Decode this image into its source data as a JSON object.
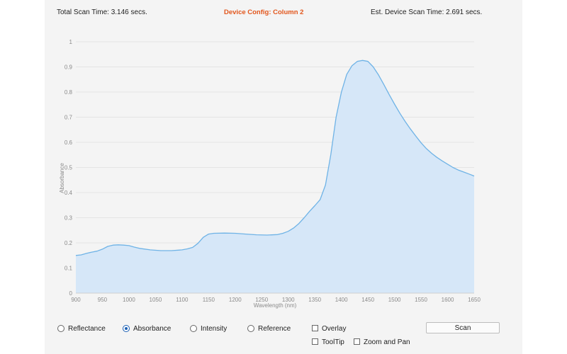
{
  "header": {
    "total_scan_time": "Total Scan Time: 3.146 secs.",
    "device_config": "Device Config: Column 2",
    "est_device_scan_time": "Est. Device Scan Time: 2.691 secs."
  },
  "colors": {
    "accent": "#e2561c",
    "fill": "#d6e7f8",
    "line": "#6fb3e6",
    "radio_selected": "#1a5fb4"
  },
  "chart_data": {
    "type": "area",
    "xlabel": "Wavelength (nm)",
    "ylabel": "Absorbance",
    "xlim": [
      900,
      1650
    ],
    "ylim": [
      0,
      1
    ],
    "x_ticks": [
      900,
      950,
      1000,
      1050,
      1100,
      1150,
      1200,
      1250,
      1300,
      1350,
      1400,
      1450,
      1500,
      1550,
      1600,
      1650
    ],
    "y_ticks": [
      0,
      0.1,
      0.2,
      0.3,
      0.4,
      0.5,
      0.6,
      0.7,
      0.8,
      0.9,
      1
    ],
    "y_tick_labels": [
      "0",
      "0.1",
      "0.2",
      "0.3",
      "0.4",
      "0.5",
      "0.6",
      "0.7",
      "0.8",
      "0.9",
      "1"
    ],
    "grid": "horizontal",
    "x": [
      900,
      910,
      920,
      930,
      940,
      950,
      960,
      970,
      980,
      990,
      1000,
      1010,
      1020,
      1040,
      1060,
      1080,
      1100,
      1110,
      1120,
      1130,
      1140,
      1150,
      1160,
      1180,
      1200,
      1220,
      1240,
      1260,
      1280,
      1290,
      1300,
      1310,
      1320,
      1330,
      1340,
      1350,
      1360,
      1370,
      1380,
      1390,
      1400,
      1410,
      1420,
      1430,
      1440,
      1450,
      1460,
      1470,
      1480,
      1490,
      1500,
      1510,
      1520,
      1530,
      1540,
      1550,
      1560,
      1570,
      1580,
      1590,
      1600,
      1610,
      1620,
      1630,
      1640,
      1650
    ],
    "y": [
      0.15,
      0.152,
      0.158,
      0.163,
      0.167,
      0.175,
      0.186,
      0.191,
      0.192,
      0.191,
      0.189,
      0.183,
      0.178,
      0.172,
      0.169,
      0.169,
      0.172,
      0.176,
      0.182,
      0.198,
      0.222,
      0.235,
      0.238,
      0.239,
      0.238,
      0.235,
      0.232,
      0.231,
      0.233,
      0.238,
      0.246,
      0.259,
      0.277,
      0.3,
      0.325,
      0.348,
      0.372,
      0.43,
      0.55,
      0.7,
      0.8,
      0.87,
      0.905,
      0.922,
      0.926,
      0.922,
      0.9,
      0.868,
      0.83,
      0.79,
      0.752,
      0.716,
      0.683,
      0.653,
      0.625,
      0.598,
      0.575,
      0.556,
      0.54,
      0.526,
      0.513,
      0.5,
      0.49,
      0.482,
      0.474,
      0.466
    ]
  },
  "controls": {
    "radios": [
      {
        "label": "Reflectance",
        "selected": false
      },
      {
        "label": "Absorbance",
        "selected": true
      },
      {
        "label": "Intensity",
        "selected": false
      },
      {
        "label": "Reference",
        "selected": false
      }
    ],
    "checkboxes": [
      {
        "label": "Overlay",
        "checked": false
      },
      {
        "label": "ToolTip",
        "checked": false
      },
      {
        "label": "Zoom and Pan",
        "checked": false
      }
    ],
    "scan_label": "Scan"
  }
}
